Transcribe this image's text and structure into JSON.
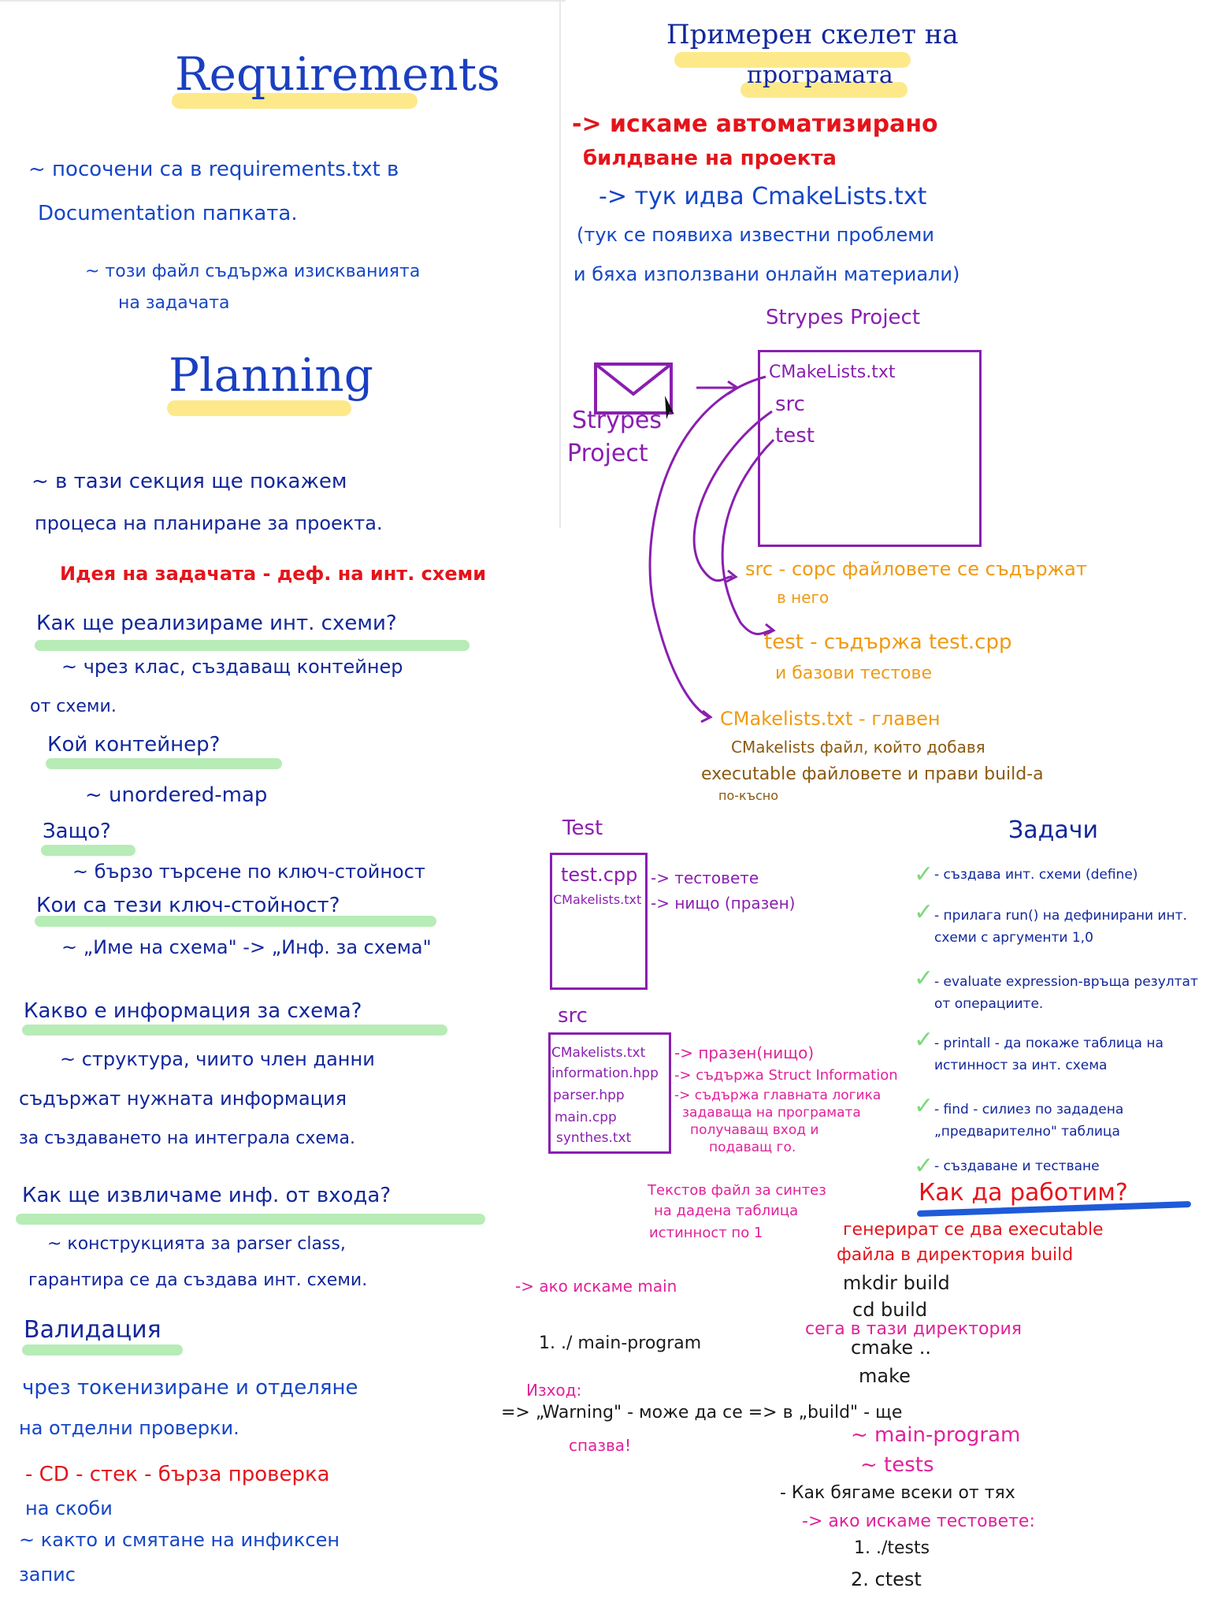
{
  "colors": {
    "blue": "#1546c6",
    "red": "#e4141b",
    "purple": "#8a1fb0",
    "orange": "#ef9a12",
    "pink": "#e0219a",
    "highlight_yellow": "#fde98a",
    "highlight_green": "#b7ecb6",
    "check_green": "#7ed77a"
  },
  "requirements": {
    "title": "Requirements",
    "line1": "~ посочени са в requirements.txt в",
    "line2": "Documentation папката.",
    "line3": "~ този файл съдържа изискванията",
    "line4": "на задачата"
  },
  "planning": {
    "title": "Planning",
    "intro1": "~ в тази секция ще покажем",
    "intro2": "процеса на планиране за проекта.",
    "idea": "Идея на задачата - деф. на инт. схеми",
    "q1": "Как ще реализираме инт. схеми?",
    "a1_1": "~ чрез клас, създаващ контейнер",
    "a1_2": "от схеми.",
    "q2": "Кой контейнер?",
    "a2": "~ unordered-map",
    "q3": "Защо?",
    "a3": "~ бързо търсене по ключ-стойност",
    "q4": "Кои са тези ключ-стойност?",
    "a4": "~ „Име на схема\" -> „Инф. за схема\"",
    "q5": "Какво е информация за схема?",
    "a5_1": "~ структура, чиито член данни",
    "a5_2": "съдържат нужната информация",
    "a5_3": "за създаването на интеграла схема.",
    "q6": "Как ще извличаме инф. от входа?",
    "a6_1": "~ конструкцията за parser class,",
    "a6_2": "гарантира се да създава инт. схеми.",
    "validation_title": "Валидация",
    "v1": "чрез токенизиране и отделяне",
    "v2": "на отделни проверки.",
    "v3": "- CD - стек - бърза проверка",
    "v4": "на скоби",
    "v5": "~ както и смятане на инфиксен",
    "v6": "запис"
  },
  "skeleton": {
    "title1": "Примерен скелет на",
    "title2": "програмата",
    "r1": "-> искаме автоматизирано",
    "r2": "билдване на проекта",
    "r3": "-> тук идва CmakeLists.txt",
    "r4": "(тук се появиха известни проблеми",
    "r5": "и бяха използвани онлайн материали)",
    "project_label": "Strypes Project",
    "folder_label1": "Strypes",
    "folder_label2": "Project",
    "tree": [
      "CMakeLists.txt",
      "src",
      "test"
    ],
    "src_desc1": "src - сорс файловете се съдържат",
    "src_desc2": "в него",
    "test_desc1": "test - съдържа test.cpp",
    "test_desc2": "и базови тестове",
    "cmake_desc1": "CMakelists.txt - главен",
    "cmake_desc2": "CMakelists файл, който добавя",
    "cmake_desc3": "executable файловете и прави build-а",
    "cmake_desc4": "по-късно"
  },
  "test_folder": {
    "label": "Test",
    "file1": "test.cpp",
    "file1_desc": "-> тестовете",
    "file2": "CMakelists.txt",
    "file2_desc": "-> нищо (празен)"
  },
  "src_folder": {
    "label": "src",
    "files": [
      {
        "name": "CMakelists.txt",
        "desc": "-> празен(нищо)"
      },
      {
        "name": "information.hpp",
        "desc": "-> съдържа Struct Information"
      },
      {
        "name": "parser.hpp",
        "desc": "-> съдържа главната логика"
      },
      {
        "name": "main.cpp",
        "desc": "задаваща на програмата"
      },
      {
        "name": "synthes.txt",
        "desc": "получаващ вход и"
      }
    ],
    "desc_extra": "подаващ го.",
    "note1": "Текстов файл за синтез",
    "note2": "на дадена таблица",
    "note3": "истинност по 1"
  },
  "run": {
    "main_label": "-> ако искаме main",
    "main_cmd": "1. ./ main-program",
    "output_label": "Изход:",
    "output_text1": "=> „Warning\" - може да се => в „build\" - ще",
    "output_text2": "спазва!"
  },
  "tasks": {
    "title": "Задачи",
    "items": [
      "- създава инт. схеми (define)",
      "- прилага run() на дефинирани инт. схеми с аргументи 1,0",
      "- evaluate expression-връща резултат от операциите.",
      "- printall - да покаже таблица на истинност за инт. схема",
      "- find - силиез по зададена „предварително\" таблица",
      "- създаване и тестване"
    ]
  },
  "how_to": {
    "title": "Как да работим?",
    "l1": "генерират се два executable",
    "l2": "файла в директория build",
    "l3": "mkdir build",
    "l4": "cd build",
    "l5": "сега в тази директория",
    "l6": "cmake ..",
    "l7": "make",
    "l8": "~ main-program",
    "l9": "~ tests",
    "l10": "- Как бягаме всеки от тях",
    "l11": "-> ако искаме тестовете:",
    "l12": "1. ./tests",
    "l13": "2. ctest"
  }
}
